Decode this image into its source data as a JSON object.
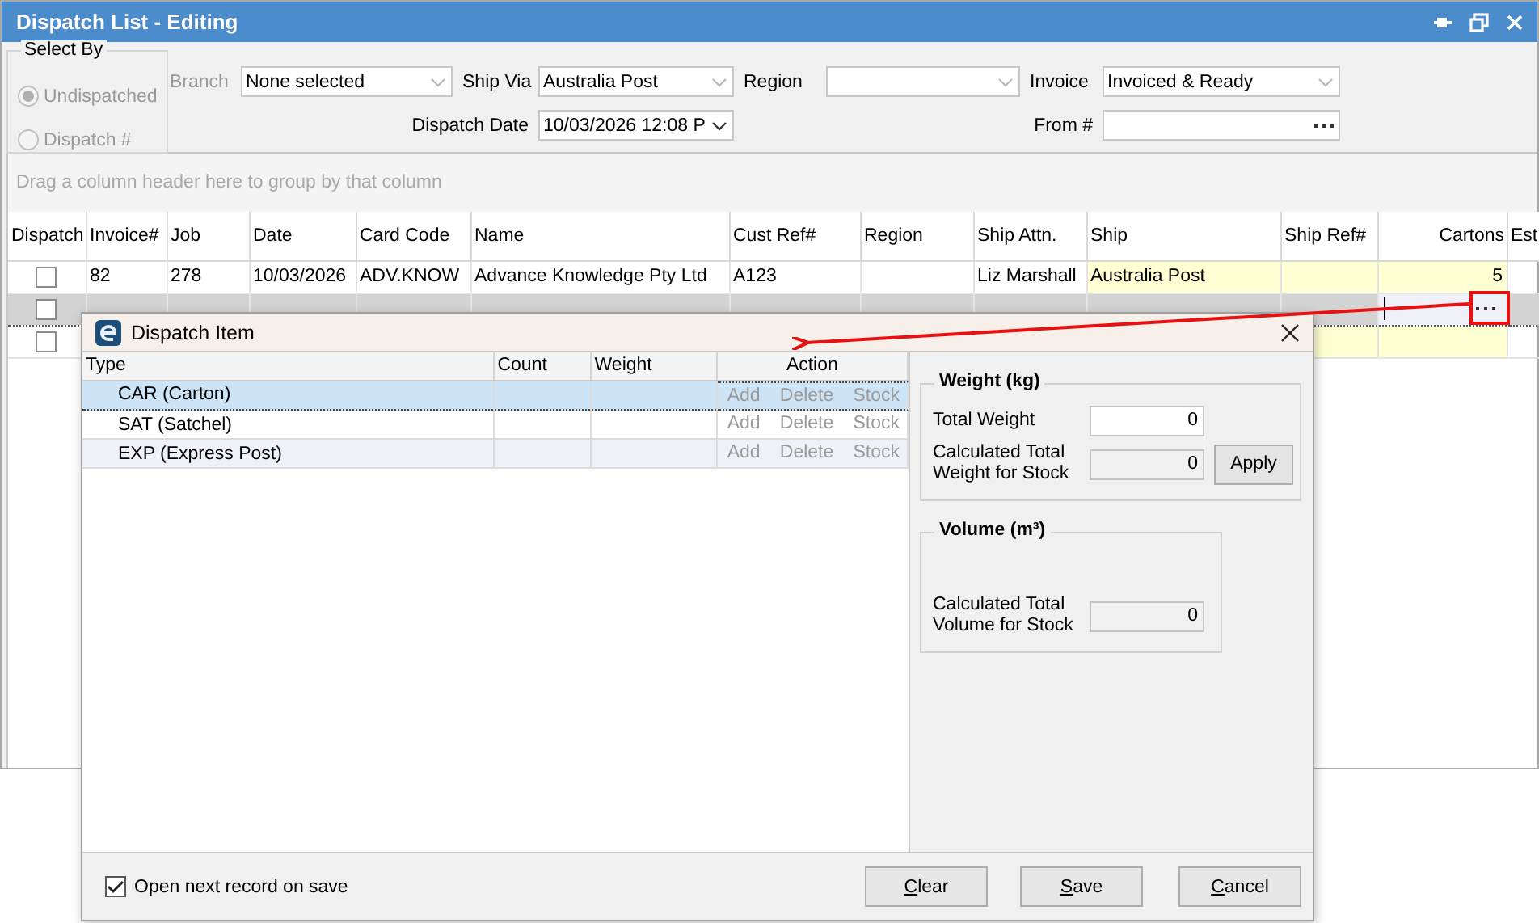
{
  "window": {
    "title": "Dispatch List - Editing"
  },
  "select_by": {
    "title": "Select By",
    "disabled": true,
    "options": [
      {
        "label": "Undispatched",
        "selected": true
      },
      {
        "label": "Dispatch #",
        "selected": false
      }
    ]
  },
  "filters": [
    [
      {
        "label": "Branch",
        "value": "None selected",
        "kind": "dropdown",
        "disabled": true
      },
      {
        "label": "Ship Via",
        "value": "Australia Post",
        "kind": "dropdown",
        "disabled": false
      },
      {
        "label": "Region",
        "kind": "dropdown",
        "disabled": false
      },
      {
        "label": "Invoice",
        "value": "Invoiced & Ready",
        "kind": "dropdown",
        "disabled": false
      }
    ],
    [
      {
        "label": "Dispatch Date",
        "value": "10/03/2026 12:08 P",
        "kind": "dropdown",
        "disabled": false
      },
      {
        "label": "From #",
        "kind": "ellipsis",
        "disabled": false
      }
    ]
  ],
  "group_panel": {
    "hint": "Drag a column header here to group by that column"
  },
  "grid": {
    "columns": [
      {
        "label": "Dispatch",
        "kind": "check",
        "editable": false
      },
      {
        "label": "Invoice#",
        "kind": "text",
        "editable": false
      },
      {
        "label": "Job",
        "kind": "text",
        "editable": false
      },
      {
        "label": "Date",
        "kind": "text",
        "editable": false
      },
      {
        "label": "Card Code",
        "kind": "text",
        "editable": false
      },
      {
        "label": "Name",
        "kind": "text",
        "editable": false
      },
      {
        "label": "Cust Ref#",
        "kind": "text",
        "editable": false
      },
      {
        "label": "Region",
        "kind": "text",
        "editable": false
      },
      {
        "label": "Ship Attn.",
        "kind": "text",
        "editable": false
      },
      {
        "label": "Ship",
        "kind": "text",
        "editable": true
      },
      {
        "label": "Ship Ref#",
        "kind": "text",
        "editable": true
      },
      {
        "label": "Cartons",
        "kind": "number",
        "editable": true
      },
      {
        "label": "Est",
        "kind": "text",
        "editable": false
      }
    ],
    "rows": [
      {
        "selected": false,
        "dispatch": false,
        "editing": false,
        "cells": [
          null,
          "82",
          "278",
          "10/03/2026",
          "ADV.KNOW",
          "Advance Knowledge Pty Ltd",
          "A123",
          null,
          "Liz Marshall",
          "Australia Post",
          null,
          "5",
          null
        ]
      },
      {
        "selected": true,
        "dispatch": false,
        "editing": true
      },
      {
        "selected": false,
        "dispatch": false,
        "editing": false
      }
    ]
  },
  "dialog": {
    "title": "Dispatch Item",
    "table": {
      "columns": [
        "Type",
        "Count",
        "Weight",
        "Action"
      ],
      "rows": [
        {
          "type": "CAR (Carton)",
          "selected": true,
          "actions": [
            "Add",
            "Delete",
            "Stock"
          ]
        },
        {
          "type": "SAT (Satchel)",
          "selected": false,
          "actions": [
            "Add",
            "Delete",
            "Stock"
          ]
        },
        {
          "type": "EXP (Express Post)",
          "selected": false,
          "actions": [
            "Add",
            "Delete",
            "Stock"
          ]
        }
      ]
    },
    "weight": {
      "title": "Weight (kg)",
      "total_label": "Total Weight",
      "total_value": "0",
      "calc_label": "Calculated Total Weight for Stock",
      "calc_value": "0",
      "apply": "Apply"
    },
    "volume": {
      "title": "Volume (m³)",
      "calc_label": "Calculated Total Volume for Stock",
      "calc_value": "0"
    },
    "open_next": {
      "label": "Open next record on save",
      "checked": true
    },
    "buttons": [
      "Clear",
      "Save",
      "Cancel"
    ]
  }
}
